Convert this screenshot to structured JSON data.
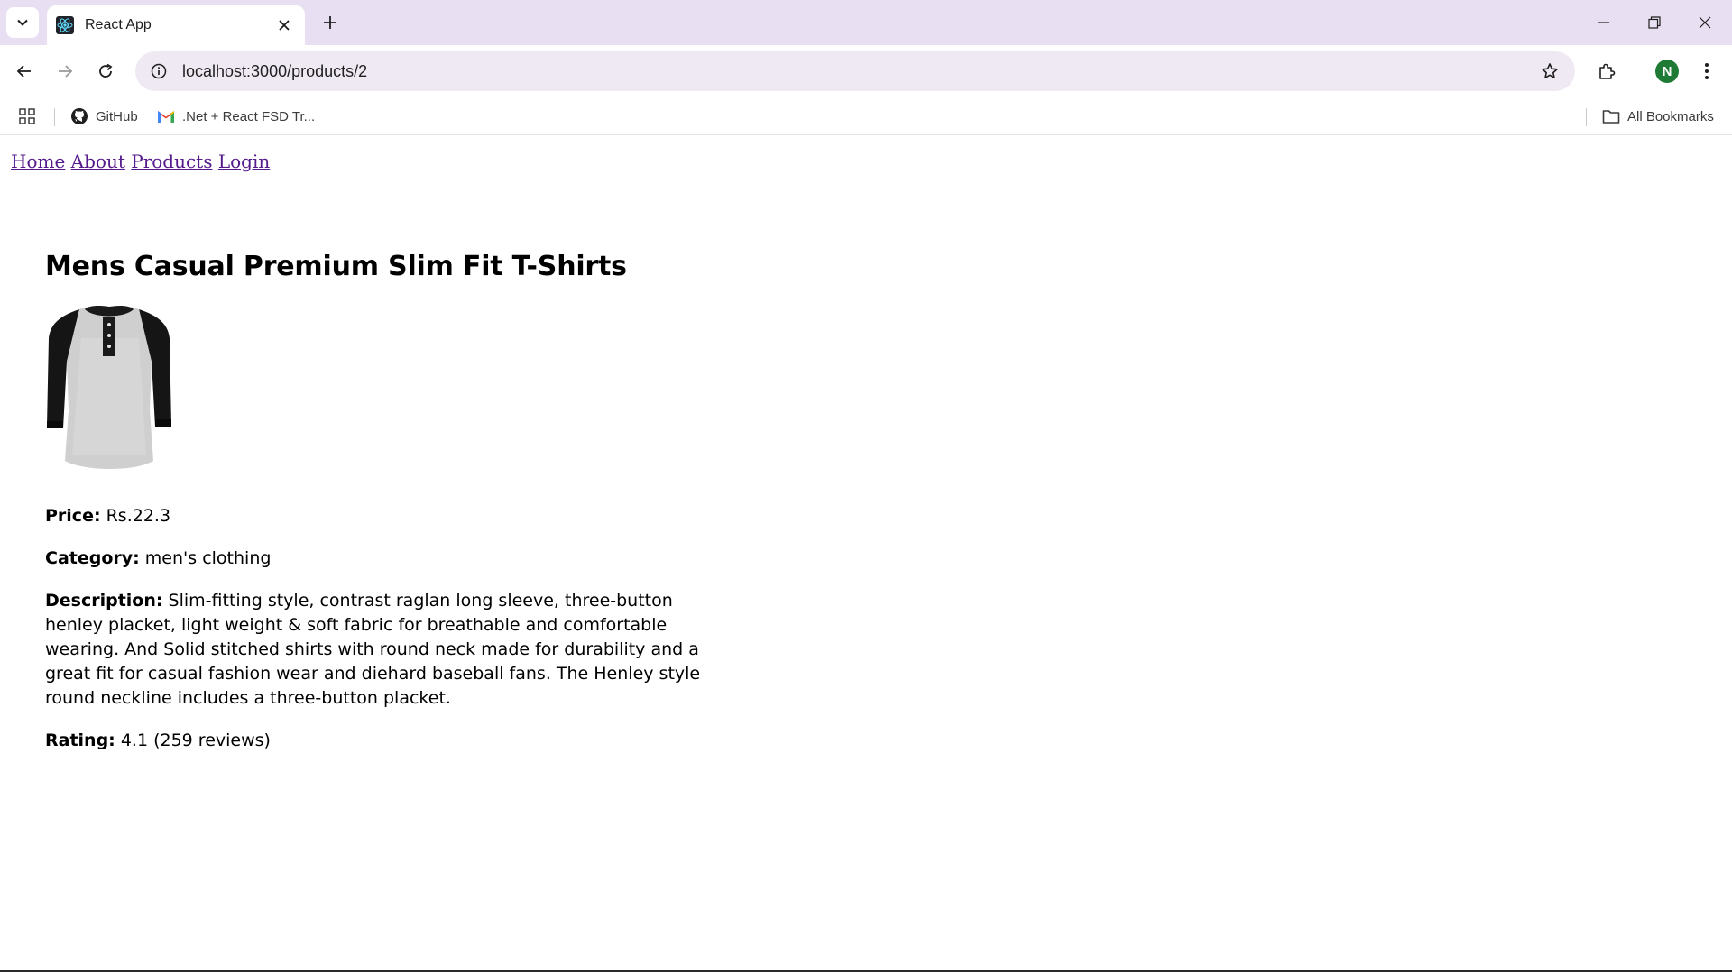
{
  "browser": {
    "tab_title": "React App",
    "url": "localhost:3000/products/2",
    "profile_initial": "N",
    "bookmarks": [
      {
        "label": "GitHub",
        "icon": "github-icon"
      },
      {
        "label": ".Net + React FSD Tr...",
        "icon": "gmail-icon"
      }
    ],
    "all_bookmarks_label": "All Bookmarks",
    "accent": "#e9dff3",
    "avatar_color": "#1e7a34"
  },
  "nav": {
    "home": "Home",
    "about": "About",
    "products": "Products",
    "login": "Login",
    "link_color": "#551a8b"
  },
  "product": {
    "title": "Mens Casual Premium Slim Fit T-Shirts",
    "image_icon": "henley-tshirt-image",
    "price_label": "Price:",
    "price_value": "Rs.22.3",
    "category_label": "Category:",
    "category_value": "men's clothing",
    "description_label": "Description:",
    "description_value": "Slim-fitting style, contrast raglan long sleeve, three-button henley placket, light weight & soft fabric for breathable and comfortable wearing. And Solid stitched shirts with round neck made for durability and a great fit for casual fashion wear and diehard baseball fans. The Henley style round neckline includes a three-button placket.",
    "rating_label": "Rating:",
    "rating_value": "4.1 (259 reviews)"
  }
}
